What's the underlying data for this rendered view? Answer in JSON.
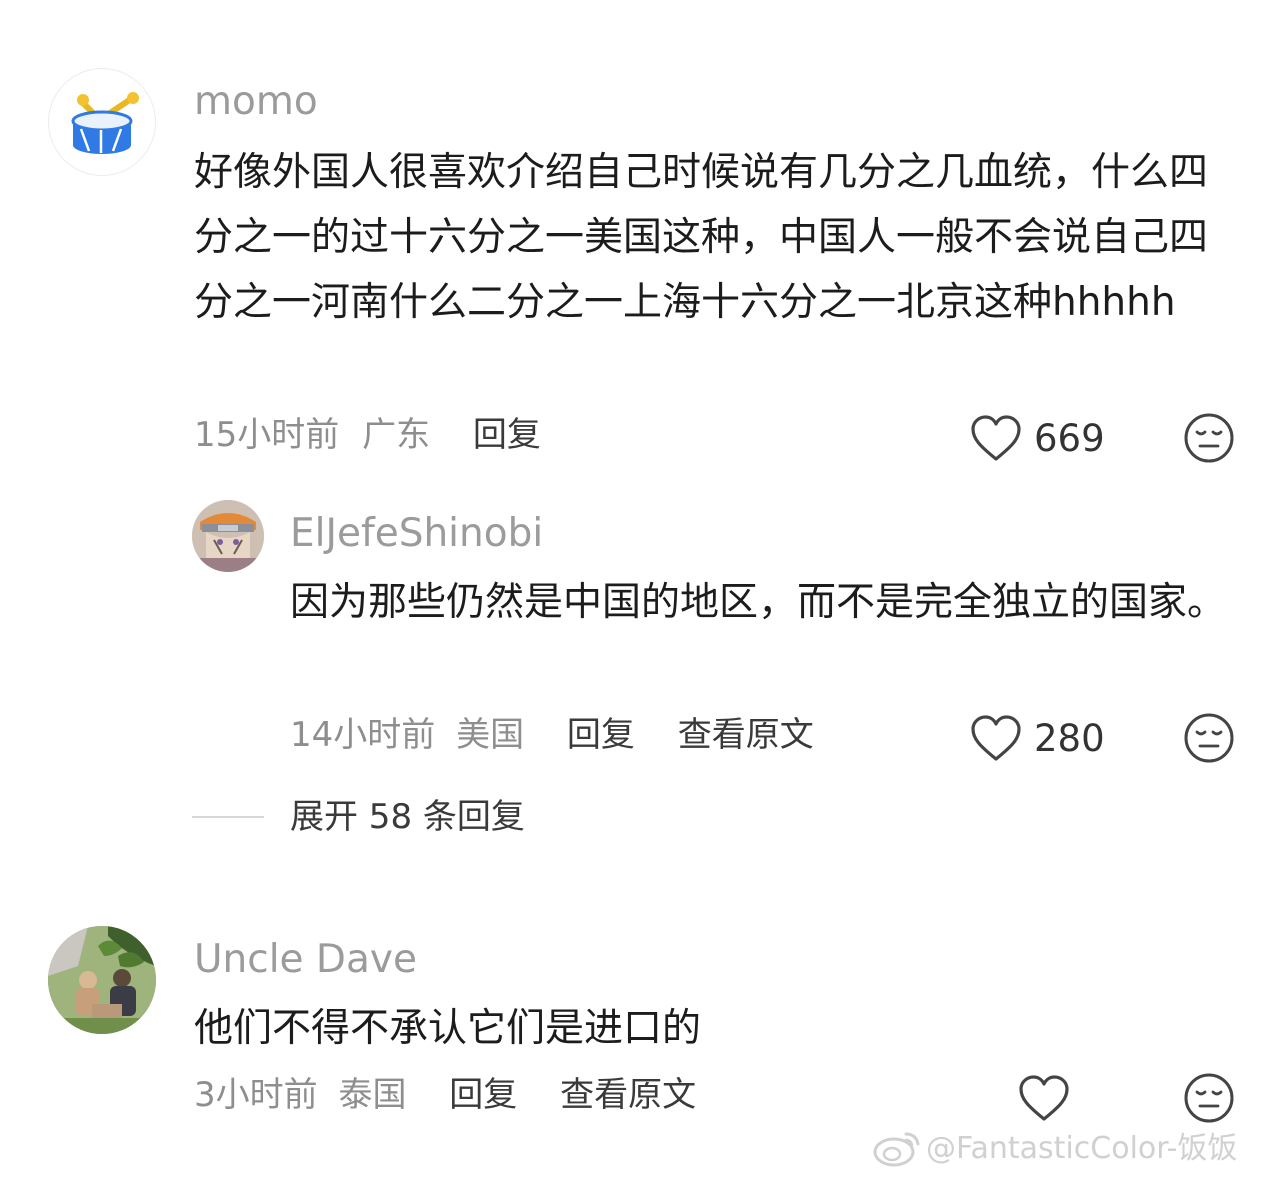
{
  "comments": [
    {
      "username": "momo",
      "text": "好像外国人很喜欢介绍自己时候说有几分之几血统，什么四分之一的过十六分之一美国这种，中国人一般不会说自己四分之一河南什么二分之一上海十六分之一北京这种hhhhh",
      "time": "15小时前",
      "location": "广东",
      "reply_label": "回复",
      "likes": "669"
    },
    {
      "username": "ElJefeShinobi",
      "text": "因为那些仍然是中国的地区，而不是完全独立的国家。",
      "time": "14小时前",
      "location": "美国",
      "reply_label": "回复",
      "view_original_label": "查看原文",
      "likes": "280"
    },
    {
      "username": "Uncle Dave",
      "text": "他们不得不承认它们是进口的",
      "time": "3小时前",
      "location": "泰国",
      "reply_label": "回复",
      "view_original_label": "查看原文",
      "likes": ""
    }
  ],
  "expand_replies": "展开 58 条回复",
  "watermark": "@FantasticColor-饭饭",
  "icons": {
    "like": "heart-icon",
    "dislike": "neutral-face-icon",
    "watermark": "weibo-logo-icon"
  },
  "colors": {
    "meta": "#8e8e8e",
    "username": "#9b9b9b",
    "drum_blue": "#2f7ae5",
    "drum_gold": "#f2c230"
  }
}
